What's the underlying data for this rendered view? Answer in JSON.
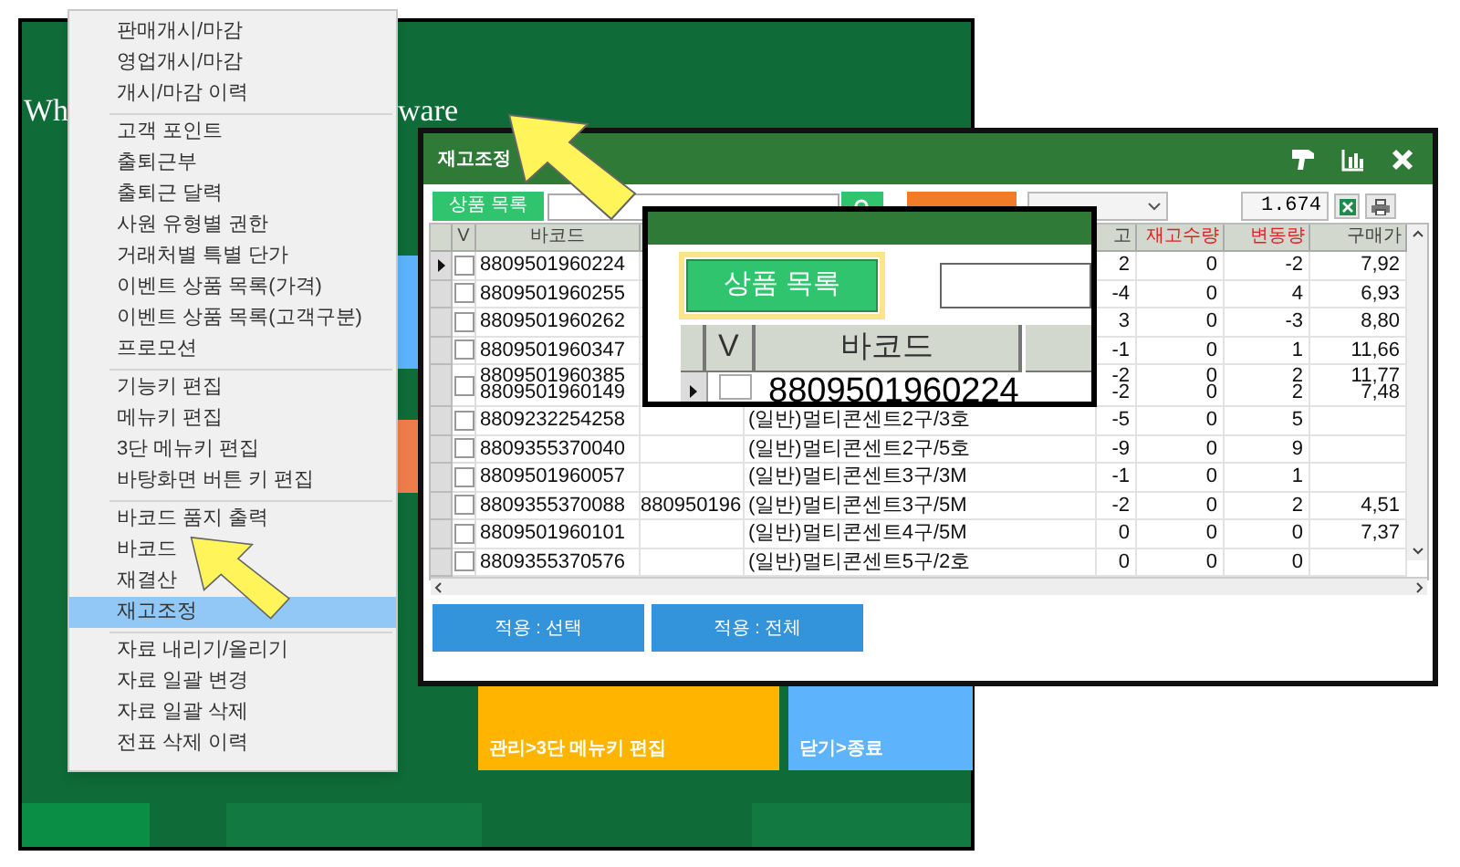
{
  "desktop": {
    "title_left": "Wh",
    "title_right": "ware",
    "tiles": [
      {
        "color": "#5cb2fb"
      },
      {
        "color": "#ef7c4b"
      },
      {
        "label": "관리>3단 메뉴키 편집",
        "color": "#ffb400"
      },
      {
        "label": "닫기>종료",
        "color": "#5eb3fd"
      }
    ]
  },
  "menu": {
    "groups": [
      [
        {
          "label": "판매개시/마감",
          "selected": false
        },
        {
          "label": "영업개시/마감",
          "selected": false
        },
        {
          "label": "개시/마감 이력",
          "selected": false
        }
      ],
      [
        {
          "label": "고객 포인트",
          "selected": false
        },
        {
          "label": "출퇴근부",
          "selected": false
        },
        {
          "label": "출퇴근 달력",
          "selected": false
        },
        {
          "label": "사원 유형별 권한",
          "selected": false
        },
        {
          "label": "거래처별 특별 단가",
          "selected": false
        },
        {
          "label": "이벤트 상품 목록(가격)",
          "selected": false
        },
        {
          "label": "이벤트 상품 목록(고객구분)",
          "selected": false
        },
        {
          "label": "프로모션",
          "selected": false
        }
      ],
      [
        {
          "label": "기능키 편집",
          "selected": false
        },
        {
          "label": "메뉴키 편집",
          "selected": false
        },
        {
          "label": "3단 메뉴키 편집",
          "selected": false
        },
        {
          "label": "바탕화면 버튼 키 편집",
          "selected": false
        }
      ],
      [
        {
          "label": "바코드 품지 출력",
          "selected": false
        },
        {
          "label": "바코드",
          "selected": false
        },
        {
          "label": "재결산",
          "selected": false
        },
        {
          "label": "재고조정",
          "selected": true
        }
      ],
      [
        {
          "label": "자료 내리기/올리기",
          "selected": false
        },
        {
          "label": "자료 일괄 변경",
          "selected": false
        },
        {
          "label": "자료 일괄 삭제",
          "selected": false
        },
        {
          "label": "전표 삭제 이력",
          "selected": false
        }
      ]
    ]
  },
  "dialog": {
    "title": "재고조정",
    "toolbar": {
      "list_button": "상품 목록",
      "count": "1.674"
    },
    "table": {
      "columns": [
        {
          "label": "V",
          "emphasized": false
        },
        {
          "label": "바코드",
          "emphasized": false
        },
        {
          "label": "고",
          "emphasized": false
        },
        {
          "label": "재고수량",
          "emphasized": true
        },
        {
          "label": "변동량",
          "emphasized": true
        },
        {
          "label": "구매가",
          "emphasized": false
        }
      ],
      "rows": [
        {
          "kind": "single",
          "selected": true,
          "checked": false,
          "barcode": "8809501960224",
          "stock": "2",
          "stock_qty": "0",
          "change": "-2",
          "price": "7,92"
        },
        {
          "kind": "single",
          "selected": false,
          "checked": false,
          "barcode": "8809501960255",
          "stock": "-4",
          "stock_qty": "0",
          "change": "4",
          "price": "6,93"
        },
        {
          "kind": "single",
          "selected": false,
          "checked": false,
          "barcode": "8809501960262",
          "stock": "3",
          "stock_qty": "0",
          "change": "-3",
          "price": "8,80"
        },
        {
          "kind": "single",
          "selected": false,
          "checked": false,
          "barcode": "8809501960347",
          "stock": "-1",
          "stock_qty": "0",
          "change": "1",
          "price": "11,66"
        },
        {
          "kind": "double",
          "selected": false,
          "checked": false,
          "barcode": "8809501960385\n8809501960149",
          "stock": "-2\n-2",
          "stock_qty": "0\n0",
          "change": "2\n2",
          "price": "11,77\n7,48"
        },
        {
          "kind": "single",
          "selected": false,
          "checked": false,
          "barcode": "8809232254258",
          "name": "(일반)멀티콘센트2구/3호",
          "stock": "-5",
          "stock_qty": "0",
          "change": "5"
        },
        {
          "kind": "single",
          "selected": false,
          "checked": false,
          "barcode": "8809355370040",
          "name": "(일반)멀티콘센트2구/5호",
          "stock": "-9",
          "stock_qty": "0",
          "change": "9"
        },
        {
          "kind": "single",
          "selected": false,
          "checked": false,
          "barcode": "8809501960057",
          "name": "(일반)멀티콘센트3구/3M",
          "stock": "-1",
          "stock_qty": "0",
          "change": "1"
        },
        {
          "kind": "single",
          "selected": false,
          "checked": false,
          "barcode": "8809355370088",
          "barcode_2": "880950196",
          "name": "(일반)멀티콘센트3구/5M",
          "stock": "-2",
          "stock_qty": "0",
          "change": "2",
          "price": "4,51"
        },
        {
          "kind": "single",
          "selected": false,
          "checked": false,
          "barcode": "8809501960101",
          "name": "(일반)멀티콘센트4구/5M",
          "stock": "0",
          "stock_qty": "0",
          "change": "0",
          "price": "7,37"
        },
        {
          "kind": "single",
          "selected": false,
          "checked": false,
          "barcode": "8809355370576",
          "name": "(일반)멀티콘센트5구/2호",
          "stock": "0",
          "stock_qty": "0",
          "change": "0"
        }
      ]
    },
    "buttons": [
      "적용 : 선택",
      "적용 : 전체"
    ]
  },
  "inset": {
    "list_button": "상품 목록",
    "columns": [
      "V",
      "바코드"
    ],
    "row": {
      "selected": true,
      "checked": false,
      "barcode": "8809501960224"
    }
  }
}
